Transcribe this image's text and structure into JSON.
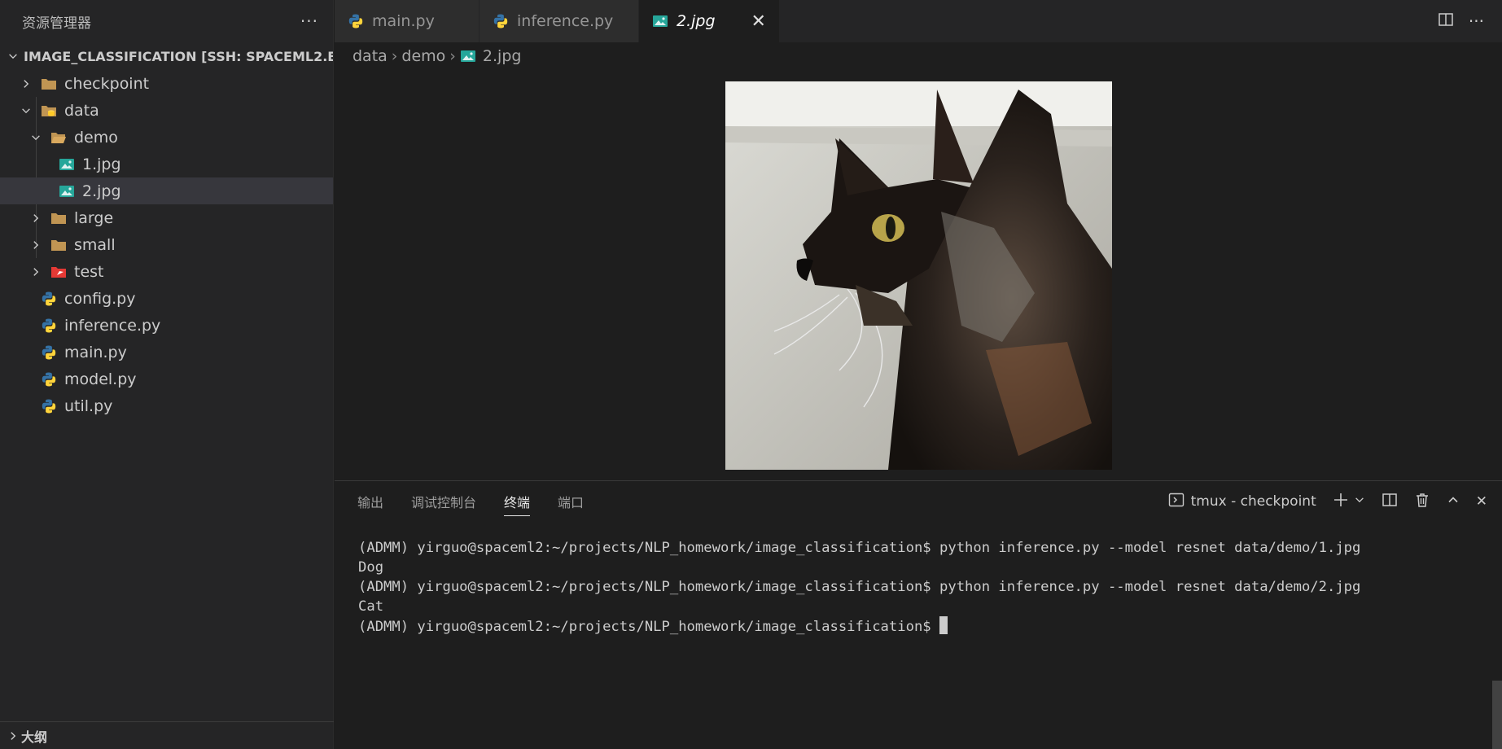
{
  "sidebar": {
    "title": "资源管理器",
    "more": "···",
    "root_label": "IMAGE_CLASSIFICATION [SSH: SPACEML2.ETH...",
    "items": [
      {
        "label": "checkpoint"
      },
      {
        "label": "data"
      },
      {
        "label": "demo"
      },
      {
        "label": "1.jpg"
      },
      {
        "label": "2.jpg"
      },
      {
        "label": "large"
      },
      {
        "label": "small"
      },
      {
        "label": "test"
      },
      {
        "label": "config.py"
      },
      {
        "label": "inference.py"
      },
      {
        "label": "main.py"
      },
      {
        "label": "model.py"
      },
      {
        "label": "util.py"
      }
    ],
    "outline_label": "大纲"
  },
  "editor": {
    "tabs": [
      {
        "label": "main.py"
      },
      {
        "label": "inference.py"
      },
      {
        "label": "2.jpg"
      }
    ],
    "breadcrumb": [
      "data",
      "demo",
      "2.jpg"
    ]
  },
  "panel": {
    "tabs": [
      "输出",
      "调试控制台",
      "终端",
      "端口"
    ],
    "terminal_name": "tmux - checkpoint",
    "lines": [
      "(ADMM) yirguo@spaceml2:~/projects/NLP_homework/image_classification$ python inference.py --model resnet data/demo/1.jpg",
      "Dog",
      "(ADMM) yirguo@spaceml2:~/projects/NLP_homework/image_classification$ python inference.py --model resnet data/demo/2.jpg",
      "Cat",
      "(ADMM) yirguo@spaceml2:~/projects/NLP_homework/image_classification$ "
    ]
  },
  "colors": {
    "python_blue": "#3572A5",
    "python_yellow": "#FFD43B",
    "image_icon": "#26a69a",
    "folder": "#c09553"
  }
}
